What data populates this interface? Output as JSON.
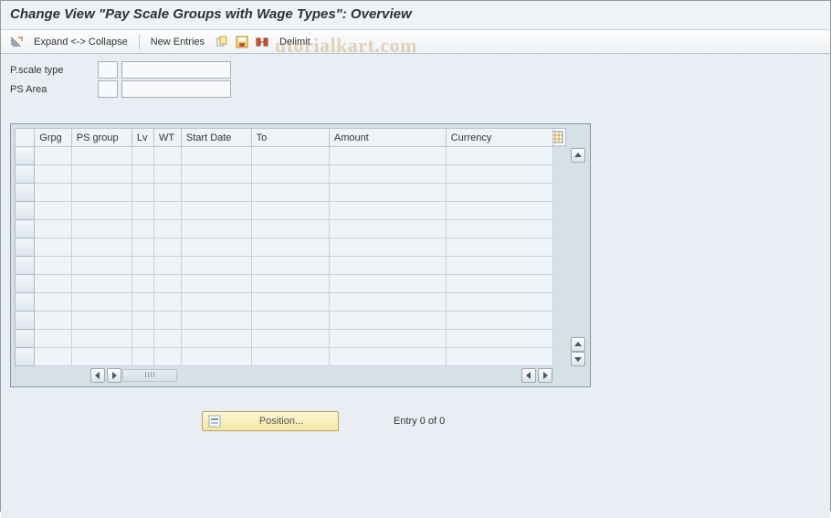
{
  "title": "Change View \"Pay Scale Groups with Wage Types\": Overview",
  "toolbar": {
    "expand_collapse": "Expand <-> Collapse",
    "new_entries": "New Entries",
    "delimit": "Delimit"
  },
  "fields": {
    "pscale_type_label": "P.scale type",
    "pscale_type_code": "",
    "pscale_type_value": "",
    "ps_area_label": "PS Area",
    "ps_area_code": "",
    "ps_area_value": ""
  },
  "grid": {
    "columns": {
      "grpg": "Grpg",
      "ps_group": "PS group",
      "lv": "Lv",
      "wt": "WT",
      "start_date": "Start Date",
      "to": "To",
      "amount": "Amount",
      "currency": "Currency"
    },
    "rows": []
  },
  "footer": {
    "position_label": "Position...",
    "status_text": "Entry 0 of 0"
  },
  "watermark": "utorialkart.com"
}
